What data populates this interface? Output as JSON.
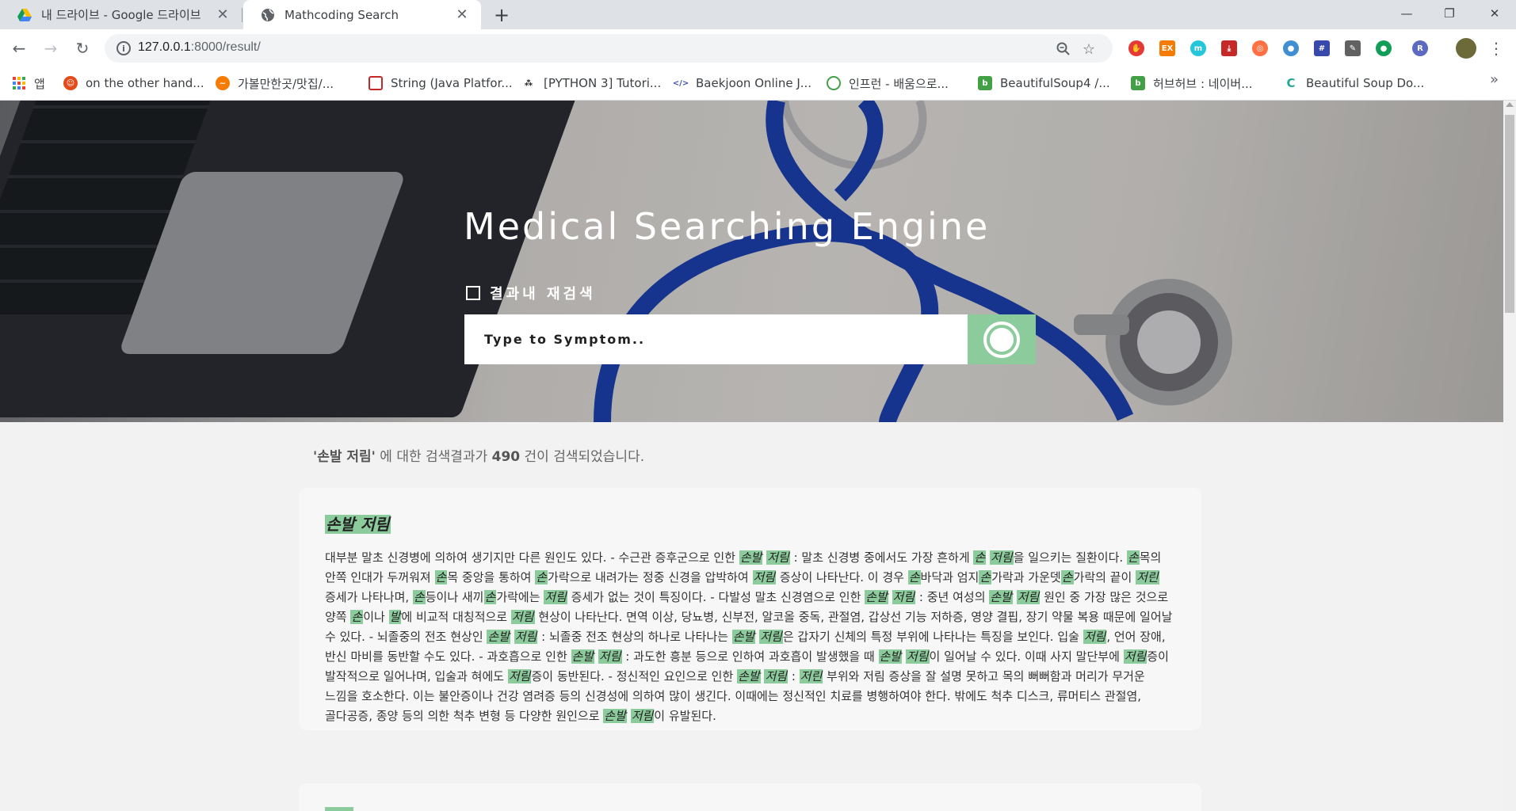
{
  "browser": {
    "tabs": [
      {
        "title": "내 드라이브 - Google 드라이브",
        "active": false,
        "icon": "google-drive-icon"
      },
      {
        "title": "Mathcoding Search",
        "active": true,
        "icon": "globe-icon"
      }
    ],
    "url_host": "127.0.0.1",
    "url_rest": ":8000/result/",
    "bookmarks": [
      {
        "label": "앱",
        "icon": "apps-grid-icon"
      },
      {
        "label": "on the other hand...",
        "icon": "bookmark-favicon"
      },
      {
        "label": "가볼만한곳/맛집/...",
        "icon": "bookmark-favicon"
      },
      {
        "label": "String (Java Platfor...",
        "icon": "bookmark-favicon"
      },
      {
        "label": "[PYTHON 3] Tutori...",
        "icon": "bookmark-favicon"
      },
      {
        "label": "Baekjoon Online J...",
        "icon": "bookmark-favicon"
      },
      {
        "label": "인프런 - 배움으로...",
        "icon": "bookmark-favicon"
      },
      {
        "label": "BeautifulSoup4 /...",
        "icon": "bookmark-favicon"
      },
      {
        "label": "허브허브 : 네이버...",
        "icon": "bookmark-favicon"
      },
      {
        "label": "Beautiful Soup Do...",
        "icon": "bookmark-favicon"
      }
    ],
    "colors": {
      "tabbar": "#dee1e6",
      "accent": "#8ccb9b"
    }
  },
  "hero": {
    "title": "Medical Searching Engine",
    "recheck_label": "결과내 재검색",
    "search_placeholder": "Type to Symptom.."
  },
  "summary": {
    "query": "'손발 저림'",
    "mid": " 에 대한 검색결과가 ",
    "count": "490",
    "tail": " 건이 검색되었습니다."
  },
  "results": [
    {
      "title": "손발 저림",
      "body_segments": [
        {
          "t": "대부분 말초 신경병에 의하여 생기지만 다른 원인도 있다. - 수근관 증후군으로 인한 "
        },
        {
          "h": "손발"
        },
        {
          "t": " "
        },
        {
          "h": "저림"
        },
        {
          "t": " : 말초 신경병 중에서도 가장 흔하게 "
        },
        {
          "h": "손"
        },
        {
          "t": " "
        },
        {
          "h": "저림"
        },
        {
          "t": "을 일으키는 질환이다. "
        },
        {
          "h": "손"
        },
        {
          "t": "목의 안쪽 인대가 두꺼워져 "
        },
        {
          "h": "손"
        },
        {
          "t": "목 중앙을 통하여 "
        },
        {
          "h": "손"
        },
        {
          "t": "가락으로 내려가는 정중 신경을 압박하여 "
        },
        {
          "h": "저림"
        },
        {
          "t": " 증상이 나타난다. 이 경우 "
        },
        {
          "h": "손"
        },
        {
          "t": "바닥과 엄지"
        },
        {
          "h": "손"
        },
        {
          "t": "가락과 가운뎃"
        },
        {
          "h": "손"
        },
        {
          "t": "가락의 끝이 "
        },
        {
          "h": "저린"
        },
        {
          "t": " 증세가 나타나며, "
        },
        {
          "h": "손"
        },
        {
          "t": "등이나 새끼"
        },
        {
          "h": "손"
        },
        {
          "t": "가락에는 "
        },
        {
          "h": "저림"
        },
        {
          "t": " 증세가 없는 것이 특징이다. - 다발성 말초 신경염으로 인한 "
        },
        {
          "h": "손발"
        },
        {
          "t": " "
        },
        {
          "h": "저림"
        },
        {
          "t": " : 중년 여성의 "
        },
        {
          "h": "손발"
        },
        {
          "t": " "
        },
        {
          "h": "저림"
        },
        {
          "t": " 원인 중 가장 많은 것으로 양쪽 "
        },
        {
          "h": "손"
        },
        {
          "t": "이나 "
        },
        {
          "h": "발"
        },
        {
          "t": "에 비교적 대칭적으로 "
        },
        {
          "h": "저림"
        },
        {
          "t": " 현상이 나타난다. 면역 이상, 당뇨병, 신부전, 알코올 중독, 관절염, 갑상선 기능 저하증, 영양 결핍, 장기 약물 복용 때문에 일어날 수 있다. - 뇌졸중의 전조 현상인 "
        },
        {
          "h": "손발"
        },
        {
          "t": " "
        },
        {
          "h": "저림"
        },
        {
          "t": " : 뇌졸중 전조 현상의 하나로 나타나는 "
        },
        {
          "h": "손발"
        },
        {
          "t": " "
        },
        {
          "h": "저림"
        },
        {
          "t": "은 갑자기 신체의 특정 부위에 나타나는 특징을 보인다. 입술 "
        },
        {
          "h": "저림"
        },
        {
          "t": ", 언어 장애, 반신 마비를 동반할 수도 있다. - 과호흡으로 인한 "
        },
        {
          "h": "손발"
        },
        {
          "t": " "
        },
        {
          "h": "저림"
        },
        {
          "t": " : 과도한 흥분 등으로 인하여 과호흡이 발생했을 때 "
        },
        {
          "h": "손발"
        },
        {
          "t": " "
        },
        {
          "h": "저림"
        },
        {
          "t": "이 일어날 수 있다. 이때 사지 말단부에 "
        },
        {
          "h": "저림"
        },
        {
          "t": "증이 발작적으로 일어나며, 입술과 혀에도 "
        },
        {
          "h": "저림"
        },
        {
          "t": "증이 동반된다. - 정신적인 요인으로 인한 "
        },
        {
          "h": "손발"
        },
        {
          "t": " "
        },
        {
          "h": "저림"
        },
        {
          "t": " : "
        },
        {
          "h": "저린"
        },
        {
          "t": " 부위와 저림 증상을 잘 설명 못하고 목의 뻐뻐함과 머리가 무거운 느낌을 호소한다. 이는 불안증이나 건강 염려증 등의 신경성에 의하여 많이 생긴다. 이때에는 정신적인 치료를 병행하여야 한다. 밖에도 척추 디스크, 류머티스 관절염, 골다공증, 종양 등의 의한 척추 변형 등 다양한 원인으로 "
        },
        {
          "h": "손발"
        },
        {
          "t": " "
        },
        {
          "h": "저림"
        },
        {
          "t": "이 유발된다."
        }
      ]
    }
  ]
}
